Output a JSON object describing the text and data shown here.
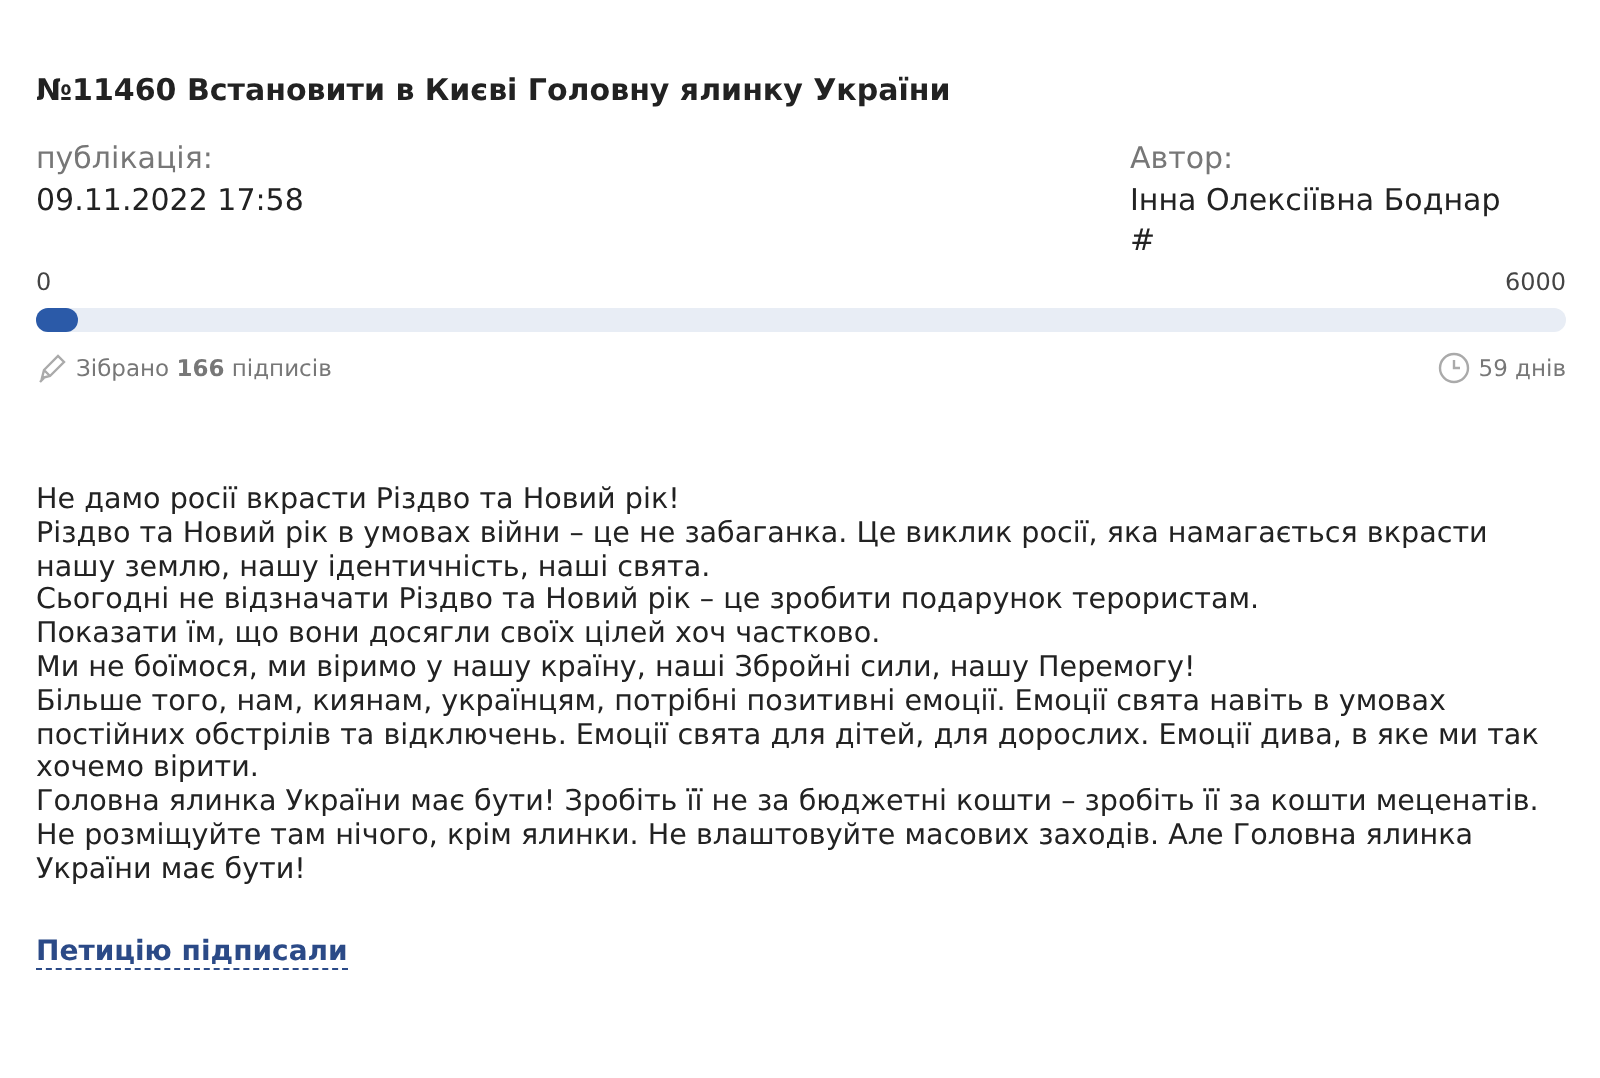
{
  "title": "№11460 Встановити в Києві Головну ялинку України",
  "published": {
    "label": "публікація:",
    "value": "09.11.2022 17:58"
  },
  "author": {
    "label": "Автор:",
    "name": "Інна Олексіївна Боднар",
    "mark": "#"
  },
  "progress": {
    "min": "0",
    "max": "6000",
    "level": 0.028
  },
  "stats": {
    "collected": "Зібрано **166** підписів",
    "days": "59 днів"
  },
  "body": [
    "Не дамо росії вкрасти Різдво та Новий рік!",
    "Різдво та Новий рік в умовах війни – це не забаганка. Це виклик росії, яка намагається вкрасти нашу землю, нашу ідентичність, наші свята.",
    "Сьогодні не відзначати Різдво та Новий рік – це зробити подарунок терористам.",
    "Показати їм, що вони досягли своїх цілей хоч частково.",
    "Ми не боїмося, ми віримо у нашу країну, наші Збройні сили, нашу Перемогу!",
    "Більше того, нам, киянам, українцям, потрібні позитивні емоції. Емоції свята навіть в умовах постійних обстрілів та відключень. Емоції свята для дітей, для дорослих. Емоції дива, в яке ми так хочемо вірити.",
    "Головна ялинка України має бути! Зробіть її не за бюджетні кошти – зробіть її за кошти меценатів. Не розміщуйте там нічого, крім ялинки. Не влаштовуйте масових заходів. Але Головна ялинка України має бути!"
  ],
  "signed_link": "Петицію підписали"
}
